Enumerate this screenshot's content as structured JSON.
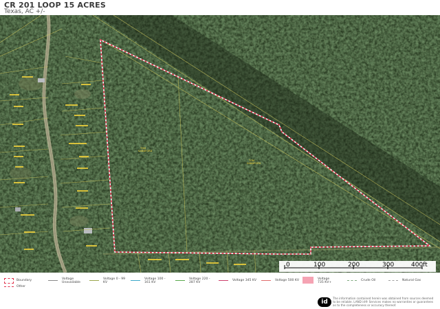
{
  "header": {
    "title": "CR 201 LOOP 15 ACRES",
    "subtitle": "Texas, AC +/-"
  },
  "scale": {
    "labels": [
      "0",
      "100",
      "200",
      "300",
      "400ft"
    ]
  },
  "parcel_labels": [
    {
      "text": "TOM"
    },
    {
      "text": "SANDFORD"
    },
    {
      "text": "TOM"
    },
    {
      "text": "SANDFORD"
    }
  ],
  "legend": {
    "items": [
      {
        "label": "Boundary",
        "color": "#e0314b"
      },
      {
        "label": "Voltage Unavailable",
        "color": "#888888"
      },
      {
        "label": "Voltage 0 - 99 KV",
        "color": "#9aa64a"
      },
      {
        "label": "Voltage 100 - 161 KV",
        "color": "#3aa7c9"
      },
      {
        "label": "Voltage 220 - 287 KV",
        "color": "#58a84a"
      },
      {
        "label": "Voltage 345 KV",
        "color": "#cc3d6b"
      },
      {
        "label": "Voltage 500 KV",
        "color": "#e06b6b"
      },
      {
        "label": "Voltage 735 KV+",
        "color": "#f5a3b3"
      },
      {
        "label": "Crude Oil",
        "color": "#7fa87f"
      },
      {
        "label": "Natural Gas",
        "color": "#a0a0a0"
      },
      {
        "label": "Other",
        "color": "#e0314b"
      }
    ]
  },
  "branding": {
    "logo": "id",
    "disclaimer": "The information contained herein was obtained from sources deemed to be reliable. LAND id® Services makes no warranties or guarantees as to the completeness or accuracy thereof."
  },
  "colors": {
    "boundary": "#e0314b",
    "parcel_line": "#c9c35a",
    "owner_label": "#f2d33b"
  }
}
